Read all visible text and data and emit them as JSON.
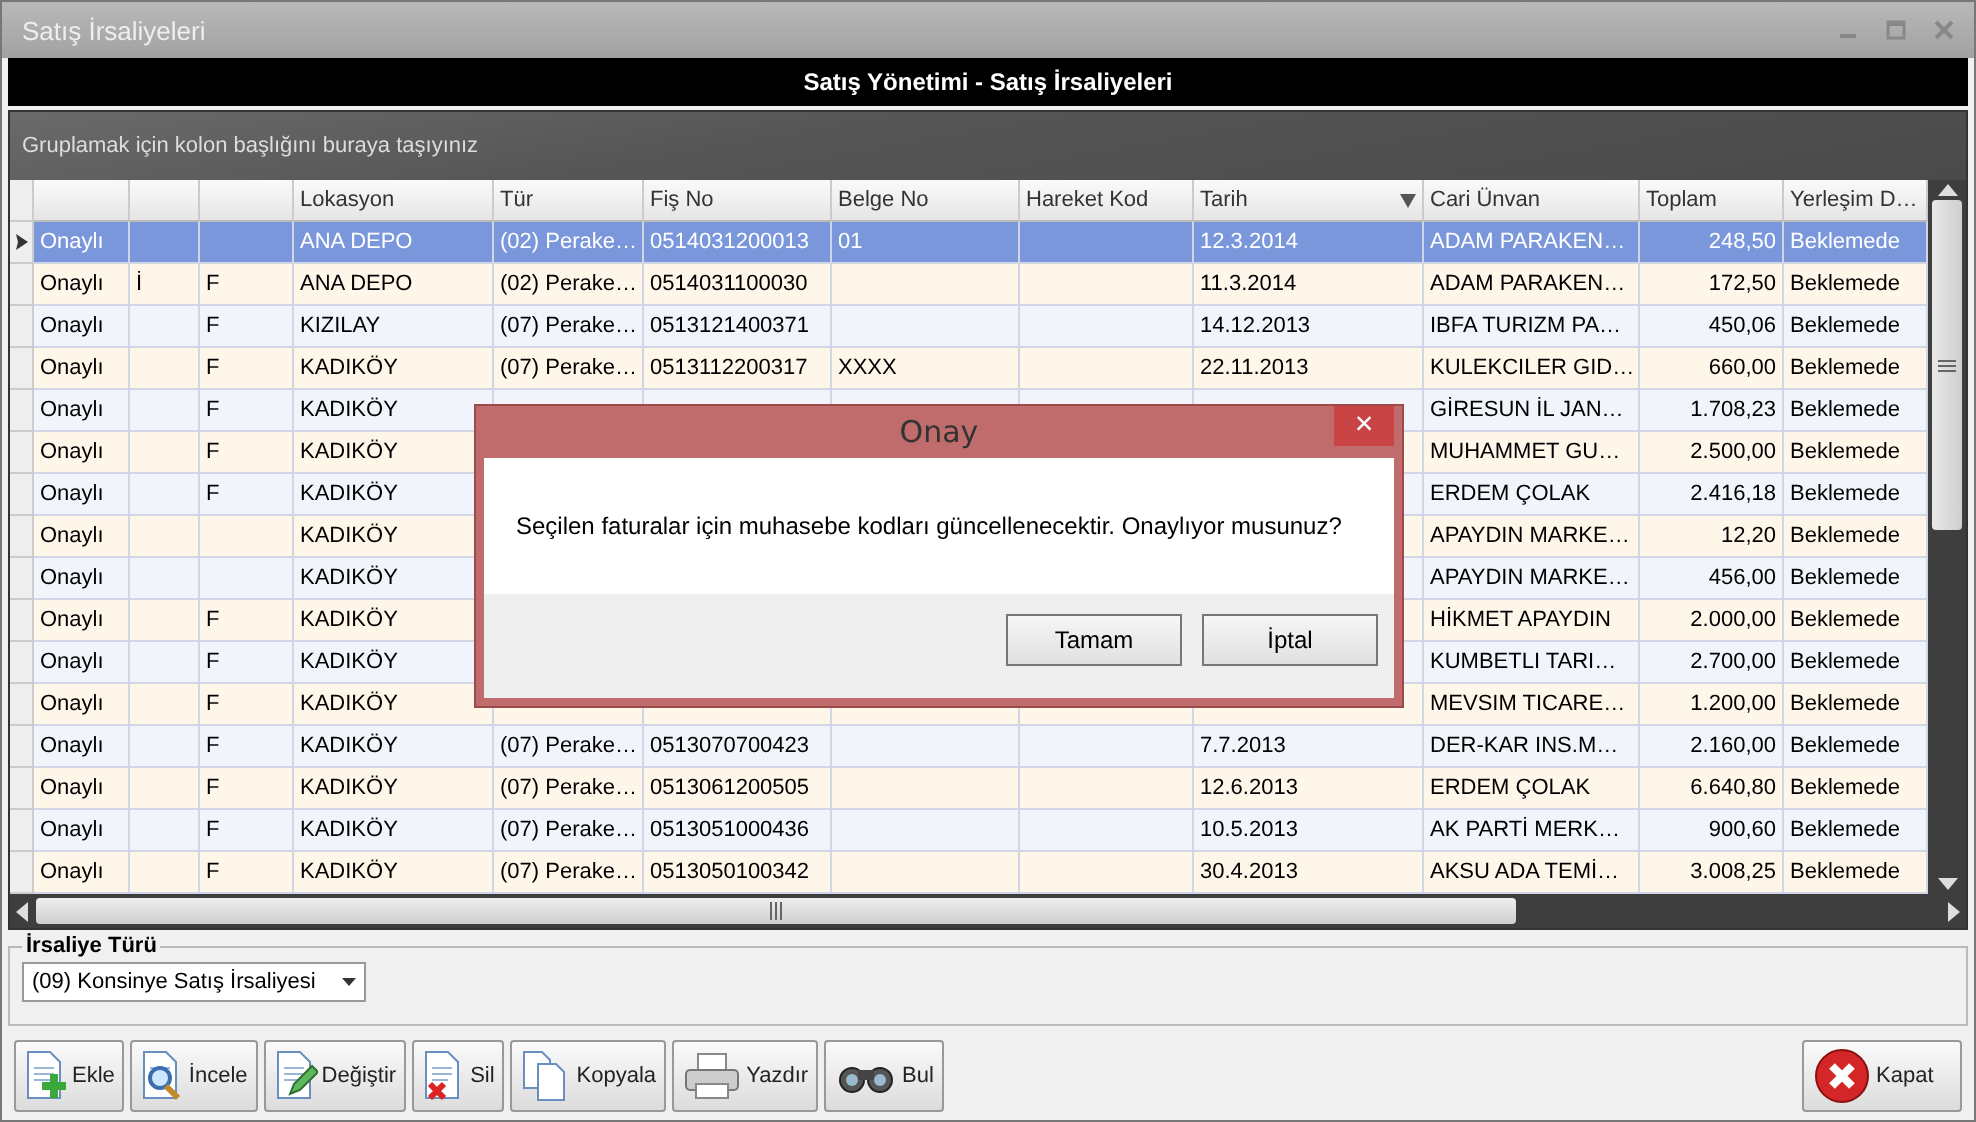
{
  "window": {
    "title": "Satış İrsaliyeleri"
  },
  "header": {
    "title": "Satış Yönetimi - Satış İrsaliyeleri"
  },
  "group_panel": {
    "hint": "Gruplamak için kolon başlığını buraya taşıyınız"
  },
  "table": {
    "columns": [
      {
        "sorted": false
      },
      {
        "sorted": false
      },
      {
        "sorted": false
      },
      {
        "label": "Lokasyon",
        "sorted": false
      },
      {
        "label": "Tür",
        "sorted": false
      },
      {
        "label": "Fiş No",
        "sorted": false
      },
      {
        "label": "Belge No",
        "sorted": false
      },
      {
        "label": "Hareket Kod",
        "sorted": false
      },
      {
        "label": "Tarih",
        "sorted": true
      },
      {
        "label": "Cari Ünvan",
        "sorted": false
      },
      {
        "label": "Toplam",
        "sorted": false
      },
      {
        "label": "Yerleşim D…",
        "sorted": false
      }
    ],
    "rows": [
      {
        "selected": true,
        "cells": [
          "Onaylı",
          null,
          null,
          "ANA DEPO",
          "(02) Perake…",
          "0514031200013",
          "01",
          null,
          "12.3.2014",
          "ADAM PARAKEN…",
          "248,50",
          "Beklemede"
        ]
      },
      {
        "selected": false,
        "cells": [
          "Onaylı",
          "İ",
          "F",
          "ANA DEPO",
          "(02) Perake…",
          "0514031100030",
          null,
          null,
          "11.3.2014",
          "ADAM PARAKEN…",
          "172,50",
          "Beklemede"
        ]
      },
      {
        "selected": false,
        "cells": [
          "Onaylı",
          null,
          "F",
          "KIZILAY",
          "(07) Perake…",
          "0513121400371",
          null,
          null,
          "14.12.2013",
          "IBFA TURIZM PA…",
          "450,06",
          "Beklemede"
        ]
      },
      {
        "selected": false,
        "cells": [
          "Onaylı",
          null,
          "F",
          "KADIKÖY",
          "(07) Perake…",
          "0513112200317",
          "XXXX",
          null,
          "22.11.2013",
          "KULEKCILER GID…",
          "660,00",
          "Beklemede"
        ]
      },
      {
        "selected": false,
        "cells": [
          "Onaylı",
          null,
          "F",
          "KADIKÖY",
          null,
          null,
          null,
          null,
          null,
          "GİRESUN İL JAN…",
          "1.708,23",
          "Beklemede"
        ]
      },
      {
        "selected": false,
        "cells": [
          "Onaylı",
          null,
          "F",
          "KADIKÖY",
          null,
          null,
          null,
          null,
          null,
          "MUHAMMET GU…",
          "2.500,00",
          "Beklemede"
        ]
      },
      {
        "selected": false,
        "cells": [
          "Onaylı",
          null,
          "F",
          "KADIKÖY",
          null,
          null,
          null,
          null,
          null,
          "ERDEM ÇOLAK",
          "2.416,18",
          "Beklemede"
        ]
      },
      {
        "selected": false,
        "cells": [
          "Onaylı",
          null,
          null,
          "KADIKÖY",
          null,
          null,
          null,
          null,
          null,
          "APAYDIN MARKE…",
          "12,20",
          "Beklemede"
        ]
      },
      {
        "selected": false,
        "cells": [
          "Onaylı",
          null,
          null,
          "KADIKÖY",
          null,
          null,
          null,
          null,
          null,
          "APAYDIN MARKE…",
          "456,00",
          "Beklemede"
        ]
      },
      {
        "selected": false,
        "cells": [
          "Onaylı",
          null,
          "F",
          "KADIKÖY",
          null,
          null,
          null,
          null,
          null,
          "HİKMET APAYDIN",
          "2.000,00",
          "Beklemede"
        ]
      },
      {
        "selected": false,
        "cells": [
          "Onaylı",
          null,
          "F",
          "KADIKÖY",
          null,
          null,
          null,
          null,
          null,
          "KUMBETLI TARI…",
          "2.700,00",
          "Beklemede"
        ]
      },
      {
        "selected": false,
        "cells": [
          "Onaylı",
          null,
          "F",
          "KADIKÖY",
          null,
          null,
          null,
          null,
          null,
          "MEVSIM TICARE…",
          "1.200,00",
          "Beklemede"
        ]
      },
      {
        "selected": false,
        "cells": [
          "Onaylı",
          null,
          "F",
          "KADIKÖY",
          "(07) Perake…",
          "0513070700423",
          null,
          null,
          "7.7.2013",
          "DER-KAR INS.M…",
          "2.160,00",
          "Beklemede"
        ]
      },
      {
        "selected": false,
        "cells": [
          "Onaylı",
          null,
          "F",
          "KADIKÖY",
          "(07) Perake…",
          "0513061200505",
          null,
          null,
          "12.6.2013",
          "ERDEM ÇOLAK",
          "6.640,80",
          "Beklemede"
        ]
      },
      {
        "selected": false,
        "cells": [
          "Onaylı",
          null,
          "F",
          "KADIKÖY",
          "(07) Perake…",
          "0513051000436",
          null,
          null,
          "10.5.2013",
          "AK PARTİ MERK…",
          "900,60",
          "Beklemede"
        ]
      },
      {
        "selected": false,
        "cells": [
          "Onaylı",
          null,
          "F",
          "KADIKÖY",
          "(07) Perake…",
          "0513050100342",
          null,
          null,
          "30.4.2013",
          "AKSU ADA TEMİ…",
          "3.008,25",
          "Beklemede"
        ]
      }
    ]
  },
  "filter": {
    "label": "İrsaliye Türü",
    "value": "(09) Konsinye Satış İrsaliyesi"
  },
  "toolbar": [
    {
      "kind": "add",
      "label": "Ekle"
    },
    {
      "kind": "view",
      "label": "İncele"
    },
    {
      "kind": "edit",
      "label": "Değiştir"
    },
    {
      "kind": "delete",
      "label": "Sil"
    },
    {
      "kind": "copy",
      "label": "Kopyala"
    },
    {
      "kind": "print",
      "label": "Yazdır"
    },
    {
      "kind": "find",
      "label": "Bul"
    },
    {
      "kind": "close",
      "label": "Kapat"
    }
  ],
  "dialog": {
    "title": "Onay",
    "close": "×",
    "message": "Seçilen faturalar için muhasebe kodları güncellenecektir. Onaylıyor musunuz?",
    "buttons": [
      "Tamam",
      "İptal"
    ]
  }
}
